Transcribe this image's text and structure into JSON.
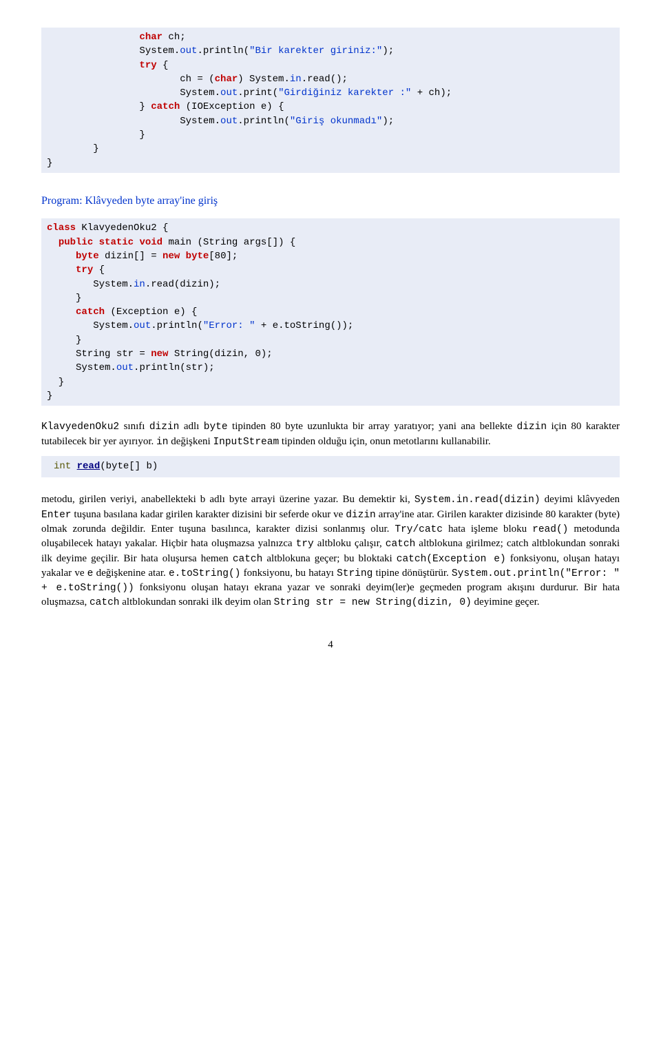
{
  "code1": {
    "l1a": "                ",
    "l1b": "char",
    "l1c": " ch;",
    "l2a": "                System.",
    "l2b": "out",
    "l2c": ".println(",
    "l2d": "\"Bir karekter giriniz:\"",
    "l2e": ");",
    "l3a": "                ",
    "l3b": "try",
    "l3c": " {",
    "l4a": "                       ch = (",
    "l4b": "char",
    "l4c": ") System.",
    "l4d": "in",
    "l4e": ".read();",
    "l5a": "                       System.",
    "l5b": "out",
    "l5c": ".print(",
    "l5d": "\"Girdiğiniz karekter :\"",
    "l5e": " + ch);",
    "l6a": "                } ",
    "l6b": "catch",
    "l6c": " (IOException e) {",
    "l7a": "                       System.",
    "l7b": "out",
    "l7c": ".println(",
    "l7d": "\"Giriş okunmadı\"",
    "l7e": ");",
    "l8": "                }",
    "l9": "        }",
    "l10": "}"
  },
  "sectionTitle": "Program: Klâvyeden byte array'ine giriş",
  "code2": {
    "l1a": "class",
    "l1b": " KlavyedenOku2 {",
    "l2a": "  ",
    "l2b": "public",
    "l2c": " ",
    "l2d": "static",
    "l2e": " ",
    "l2f": "void",
    "l2g": " main (String args[]) {",
    "l3a": "     ",
    "l3b": "byte",
    "l3c": " dizin[] = ",
    "l3d": "new",
    "l3e": " ",
    "l3f": "byte",
    "l3g": "[80];",
    "l4a": "     ",
    "l4b": "try",
    "l4c": " {",
    "l5a": "        System.",
    "l5b": "in",
    "l5c": ".read(dizin);",
    "l6": "     }",
    "l7a": "     ",
    "l7b": "catch",
    "l7c": " (Exception e) {",
    "l8a": "        System.",
    "l8b": "out",
    "l8c": ".println(",
    "l8d": "\"Error: \"",
    "l8e": " + e.toString());",
    "l9": "     }",
    "l10a": "     String str = ",
    "l10b": "new",
    "l10c": " String(dizin, 0);",
    "l11a": "     System.",
    "l11b": "out",
    "l11c": ".println(str);",
    "l12": "  }",
    "l13": "}"
  },
  "para1": {
    "t1": "KlavyedenOku2",
    "t2": " sınıfı ",
    "t3": "dizin",
    "t4": " adlı ",
    "t5": "byte",
    "t6": " tipinden 80 byte uzunlukta bir array yaratıyor; yani ana bellekte ",
    "t7": "dizin",
    "t8": " için 80 karakter tutabilecek bir yer ayırıyor. ",
    "t9": "in",
    "t10": " değişkeni ",
    "t11": "InputStream",
    "t12": " tipinden olduğu için, onun metotlarını kullanabilir."
  },
  "code3a": "int",
  "code3b": " ",
  "code3c": "read",
  "code3d": "(byte[] b)",
  "para2": {
    "t1": "metodu, girilen veriyi, anabellekteki b adlı byte arrayi üzerine yazar. Bu demektir ki, ",
    "t2": "System.in.read(dizin)",
    "t3": " deyimi klâvyeden ",
    "t4": "Enter",
    "t5": " tuşuna basılana kadar girilen karakter dizisini bir seferde okur ve ",
    "t6": "dizin",
    "t7": " array'ine atar. Girilen karakter dizisinde 80 karakter (byte) olmak zorunda değildir. Enter tuşuna basılınca, karakter dizisi sonlanmış olur. ",
    "t8": "Try/catc",
    "t9": " hata işleme bloku ",
    "t10": "read()",
    "t11": " metodunda oluşabilecek hatayı yakalar. Hiçbir hata oluşmazsa yalnızca ",
    "t12": "try",
    "t13": " altbloku çalışır, ",
    "t14": "catch",
    "t15": " altblokuna girilmez; catch altblokundan sonraki ilk deyime geçilir. Bir hata oluşursa hemen ",
    "t16": "catch",
    "t17": " altblokuna geçer; bu bloktaki ",
    "t18": "catch(Exception e)",
    "t19": " fonksiyonu, oluşan hatayı yakalar ve ",
    "t20": "e",
    "t21": " değişkenine atar. ",
    "t22": "e.toString()",
    "t23": " fonksiyonu, bu hatayı ",
    "t24": "String",
    "t25": " tipine dönüştürür. ",
    "t26": "System.out.println(\"Error: \" + e.toString())",
    "t27": " fonksiyonu oluşan hatayı ekrana yazar ve sonraki deyim(ler)e  geçmeden program akışını durdurur. Bir hata oluşmazsa, ",
    "t28": "catch",
    "t29": " altblokundan sonraki ilk deyim olan ",
    "t30": "String str = new String(dizin, 0)",
    "t31": " deyimine geçer."
  },
  "pageNum": "4"
}
